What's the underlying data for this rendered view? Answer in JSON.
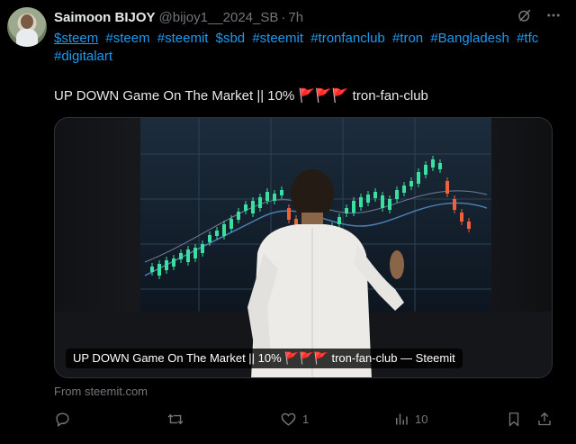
{
  "author": {
    "name": "Saimoon BIJOY",
    "handle": "@bijoy1__2024_SB",
    "separator": "·",
    "time": "7h"
  },
  "hashtags": [
    "$steem",
    "#steem",
    "#steemit",
    "$sbd",
    "#steemit",
    "#tronfanclub",
    "#tron",
    "#Bangladesh",
    "#tfc",
    "#digitalart"
  ],
  "post_title": "UP DOWN Game On The Market  || 10% 🚩🚩🚩 tron-fan-club",
  "card": {
    "caption": "UP DOWN Game On The Market || 10% 🚩🚩🚩 tron-fan-club — Steemit",
    "source": "From steemit.com"
  },
  "actions": {
    "reply_count": "",
    "repost_count": "",
    "like_count": "1",
    "view_count": "10"
  },
  "icons": [
    "grok-icon",
    "more-icon",
    "reply-icon",
    "repost-icon",
    "like-icon",
    "views-icon",
    "bookmark-icon",
    "share-icon"
  ],
  "colors": {
    "link": "#1d9bf0",
    "muted": "#71767b",
    "text": "#e7e9ea",
    "candle_up": "#39e0a0",
    "candle_down": "#f0603a"
  }
}
